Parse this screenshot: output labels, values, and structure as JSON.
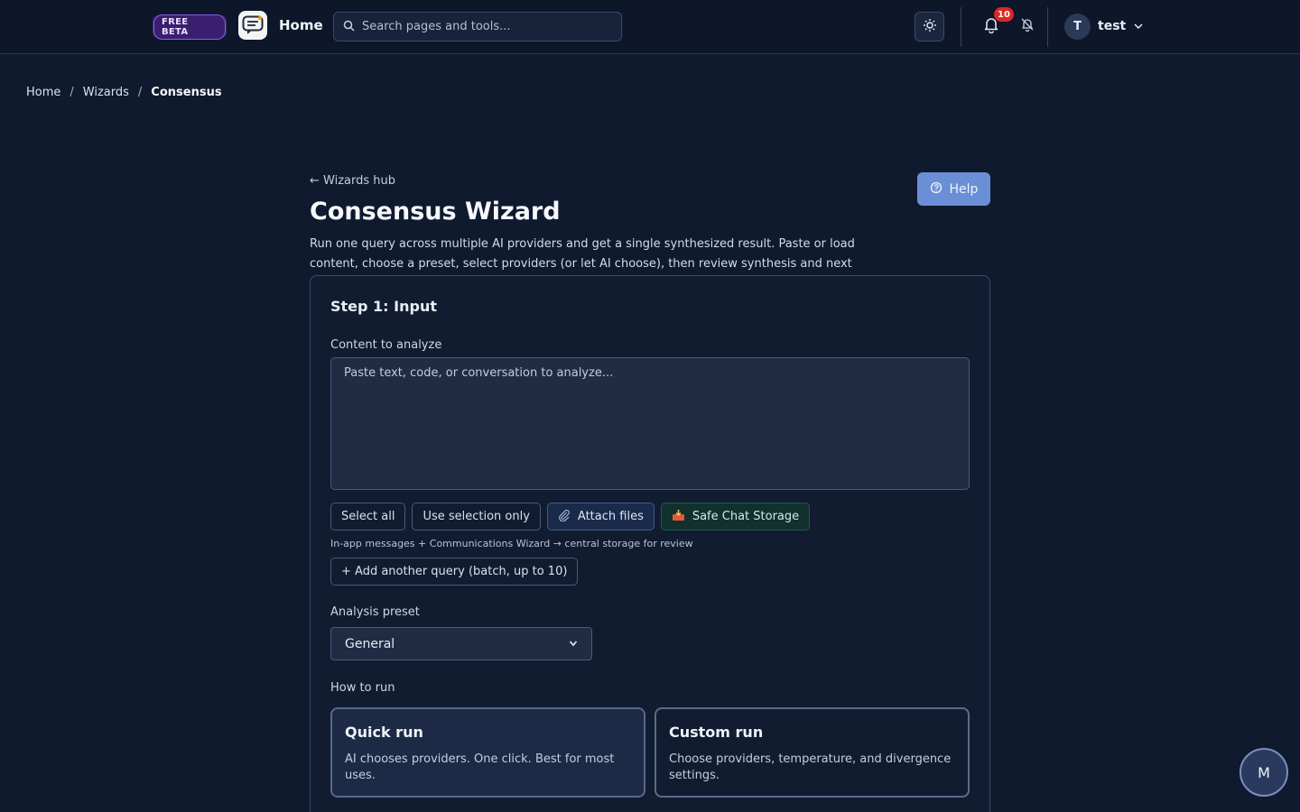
{
  "header": {
    "beta_label": "FREE BETA",
    "home_label": "Home",
    "search_placeholder": "Search pages and tools...",
    "notification_count": "10",
    "user_initial": "T",
    "user_name": "test"
  },
  "breadcrumb": {
    "items": [
      "Home",
      "Wizards",
      "Consensus"
    ],
    "separator": "/"
  },
  "page": {
    "back_link": "← Wizards hub",
    "help_label": "Help",
    "title": "Consensus Wizard",
    "description": "Run one query across multiple AI providers and get a single synthesized result. Paste or load content, choose a preset, select providers (or let AI choose), then review synthesis and next steps."
  },
  "step1": {
    "title": "Step 1: Input",
    "content_label": "Content to analyze",
    "content_placeholder": "Paste text, code, or conversation to analyze...",
    "buttons": {
      "select_all": "Select all",
      "use_selection": "Use selection only",
      "attach_files": "Attach files",
      "safe_chat": "Safe Chat Storage"
    },
    "hint": "In-app messages + Communications Wizard → central storage for review",
    "add_query": "+ Add another query (batch, up to 10)",
    "preset_label": "Analysis preset",
    "preset_value": "General",
    "how_to_run_label": "How to run",
    "quick_run": {
      "title": "Quick run",
      "desc": "AI chooses providers. One click. Best for most uses."
    },
    "custom_run": {
      "title": "Custom run",
      "desc": "Choose providers, temperature, and divergence settings."
    }
  },
  "fab_label": "M",
  "colors": {
    "background": "#0f1a2e",
    "accent": "#6b8fd6",
    "badge": "#dc2626",
    "beta": "#8b5cf6"
  }
}
